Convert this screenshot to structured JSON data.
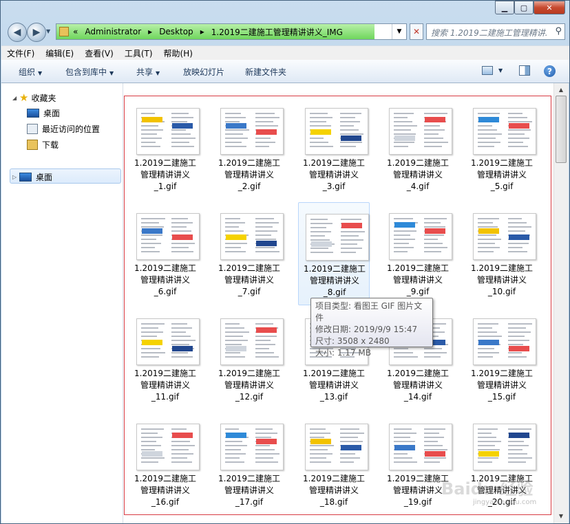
{
  "address": {
    "crumbs": [
      "«",
      "Administrator",
      "▸",
      "Desktop",
      "▸",
      "1.2019二建施工管理精讲讲义_IMG"
    ]
  },
  "search": {
    "placeholder": "搜索 1.2019二建施工管理精讲..."
  },
  "menu": [
    "文件(F)",
    "编辑(E)",
    "查看(V)",
    "工具(T)",
    "帮助(H)"
  ],
  "toolbar": {
    "organize": "组织",
    "include": "包含到库中",
    "share": "共享",
    "slideshow": "放映幻灯片",
    "newfolder": "新建文件夹"
  },
  "nav": {
    "favorites": "收藏夹",
    "desktop": "桌面",
    "recent": "最近访问的位置",
    "downloads": "下载",
    "desktop_root": "桌面"
  },
  "files": [
    {
      "l1": "1.2019二建施工",
      "l2": "管理精讲讲义",
      "l3": "_1.gif"
    },
    {
      "l1": "1.2019二建施工",
      "l2": "管理精讲讲义",
      "l3": "_2.gif"
    },
    {
      "l1": "1.2019二建施工",
      "l2": "管理精讲讲义",
      "l3": "_3.gif"
    },
    {
      "l1": "1.2019二建施工",
      "l2": "管理精讲讲义",
      "l3": "_4.gif"
    },
    {
      "l1": "1.2019二建施工",
      "l2": "管理精讲讲义",
      "l3": "_5.gif"
    },
    {
      "l1": "1.2019二建施工",
      "l2": "管理精讲讲义",
      "l3": "_6.gif"
    },
    {
      "l1": "1.2019二建施工",
      "l2": "管理精讲讲义",
      "l3": "_7.gif"
    },
    {
      "l1": "1.2019二建施工",
      "l2": "管理精讲讲义",
      "l3": "_8.gif"
    },
    {
      "l1": "1.2019二建施工",
      "l2": "管理精讲讲义",
      "l3": "_9.gif"
    },
    {
      "l1": "1.2019二建施工",
      "l2": "管理精讲讲义",
      "l3": "_10.gif"
    },
    {
      "l1": "1.2019二建施工",
      "l2": "管理精讲讲义",
      "l3": "_11.gif"
    },
    {
      "l1": "1.2019二建施工",
      "l2": "管理精讲讲义",
      "l3": "_12.gif"
    },
    {
      "l1": "1.2019二建施工",
      "l2": "管理精讲讲义",
      "l3": "_13.gif"
    },
    {
      "l1": "1.2019二建施工",
      "l2": "管理精讲讲义",
      "l3": "_14.gif"
    },
    {
      "l1": "1.2019二建施工",
      "l2": "管理精讲讲义",
      "l3": "_15.gif"
    },
    {
      "l1": "1.2019二建施工",
      "l2": "管理精讲讲义",
      "l3": "_16.gif"
    },
    {
      "l1": "1.2019二建施工",
      "l2": "管理精讲讲义",
      "l3": "_17.gif"
    },
    {
      "l1": "1.2019二建施工",
      "l2": "管理精讲讲义",
      "l3": "_18.gif"
    },
    {
      "l1": "1.2019二建施工",
      "l2": "管理精讲讲义",
      "l3": "_19.gif"
    },
    {
      "l1": "1.2019二建施工",
      "l2": "管理精讲讲义",
      "l3": "_20.gif"
    }
  ],
  "tooltip": {
    "type": "项目类型: 看图王 GIF 图片文件",
    "date": "修改日期: 2019/9/9 15:47",
    "size": "尺寸: 3508 x 2480",
    "filesize": "大小: 1.17 MB"
  },
  "watermark": {
    "main": "Baidu 经验",
    "sub": "jingyan.baidu.com"
  },
  "colors": {
    "accent": "#d83a42",
    "address_progress": "#6fd65d"
  }
}
